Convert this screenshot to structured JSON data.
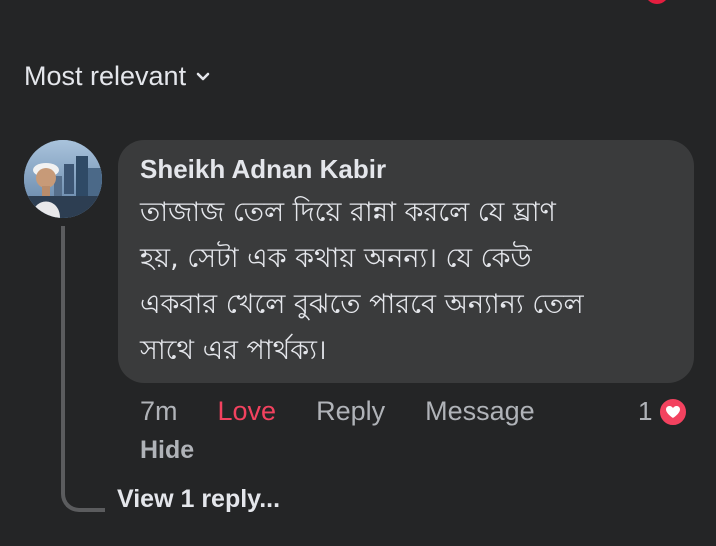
{
  "colors": {
    "background": "#242526",
    "bubble": "#3a3b3c",
    "text_primary": "#e4e6eb",
    "text_secondary": "#b0b3b8",
    "love": "#f3425f",
    "thread_line": "#5b5c5e"
  },
  "sort": {
    "label": "Most relevant",
    "icon": "chevron-down-icon"
  },
  "comment": {
    "author": "Sheikh Adnan Kabir",
    "text": "তাজাজ তেল দিয়ে রান্না করলে যে ঘ্রাণ\nহয়, সেটা এক কথায় অনন্য। যে কেউ\nএকবার খেলে বুঝতে পারবে অন্যান্য তেল\nসাথে এর পার্থক্য।",
    "time": "7m",
    "love_label": "Love",
    "reply_label": "Reply",
    "message_label": "Message",
    "hide_label": "Hide",
    "reaction_count": "1",
    "reaction_icon": "heart-icon"
  },
  "replies": {
    "view_label": "View 1 reply..."
  }
}
